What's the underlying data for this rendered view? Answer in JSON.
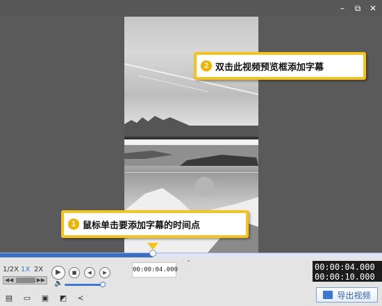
{
  "window": {
    "minimize_glyph": "–",
    "maximize_glyph": "⧉",
    "close_glyph": "✕"
  },
  "callouts": {
    "top": {
      "number": "2",
      "text": "双击此视频预览框添加字幕"
    },
    "bottom": {
      "number": "1",
      "text": "鼠标单击要添加字幕的时间点"
    }
  },
  "timeline": {
    "progress": 0.4,
    "tooltip_time": "00:00:04.000"
  },
  "speed_options": [
    "1/2X",
    "1X",
    "2X"
  ],
  "active_speed": "1X",
  "timecode": {
    "current": "00:00:04.000",
    "total": "00:00:10.000"
  },
  "export_button": {
    "label": "导出视频"
  },
  "icons": [
    "add-subtitle-icon",
    "open-folder-icon",
    "save-icon",
    "save-as-icon",
    "share-icon"
  ],
  "colors": {
    "accent": "#3c6fc4",
    "callout": "#f6c21c",
    "timecode_bg": "#1c1c1c"
  }
}
